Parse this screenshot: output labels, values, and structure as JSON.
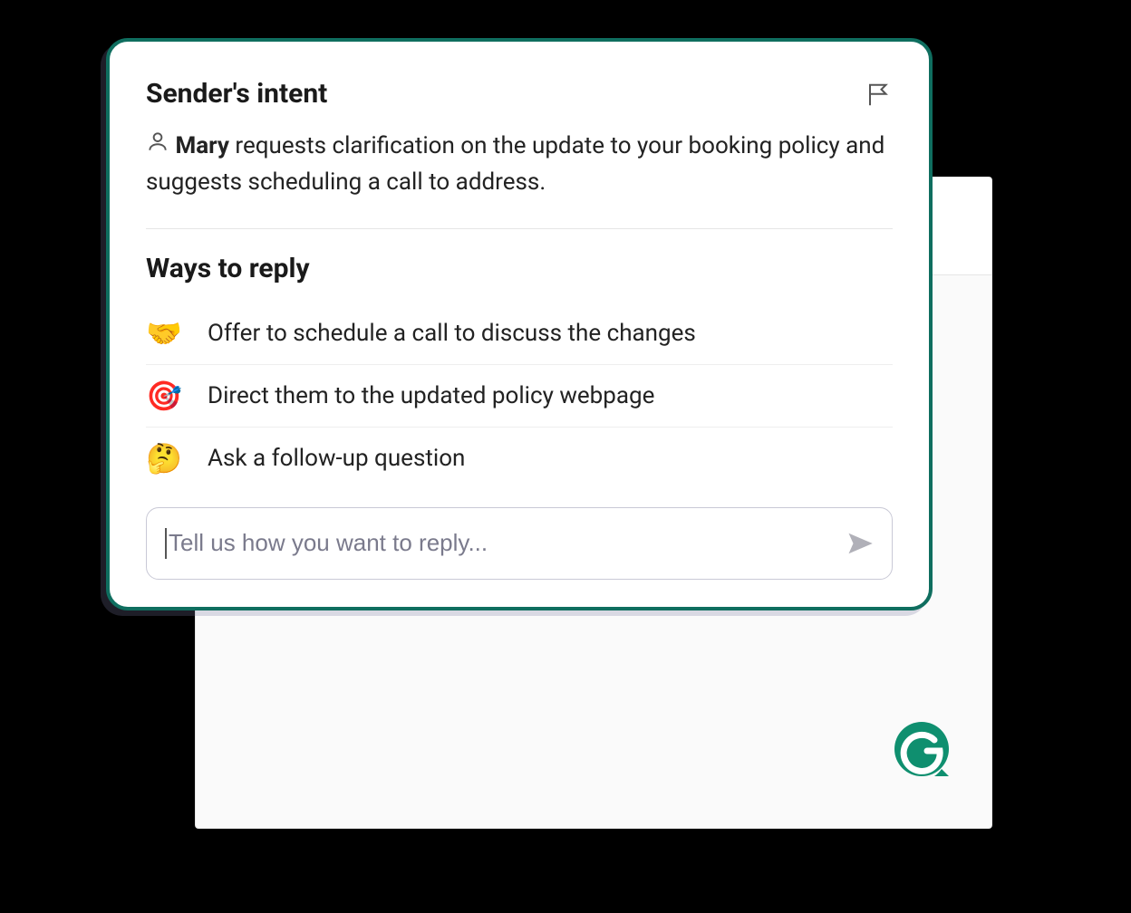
{
  "intent": {
    "title": "Sender's intent",
    "sender_name": "Mary",
    "summary_rest": " requests clarification on the update to your booking policy and suggests scheduling a call to address."
  },
  "replies": {
    "title": "Ways to reply",
    "items": [
      {
        "emoji": "🤝",
        "label": "Offer to schedule a call to discuss the changes"
      },
      {
        "emoji": "🎯",
        "label": "Direct them to the updated policy webpage"
      },
      {
        "emoji": "🤔",
        "label": "Ask a follow-up question"
      }
    ]
  },
  "input": {
    "placeholder": "Tell us how you want to reply..."
  }
}
